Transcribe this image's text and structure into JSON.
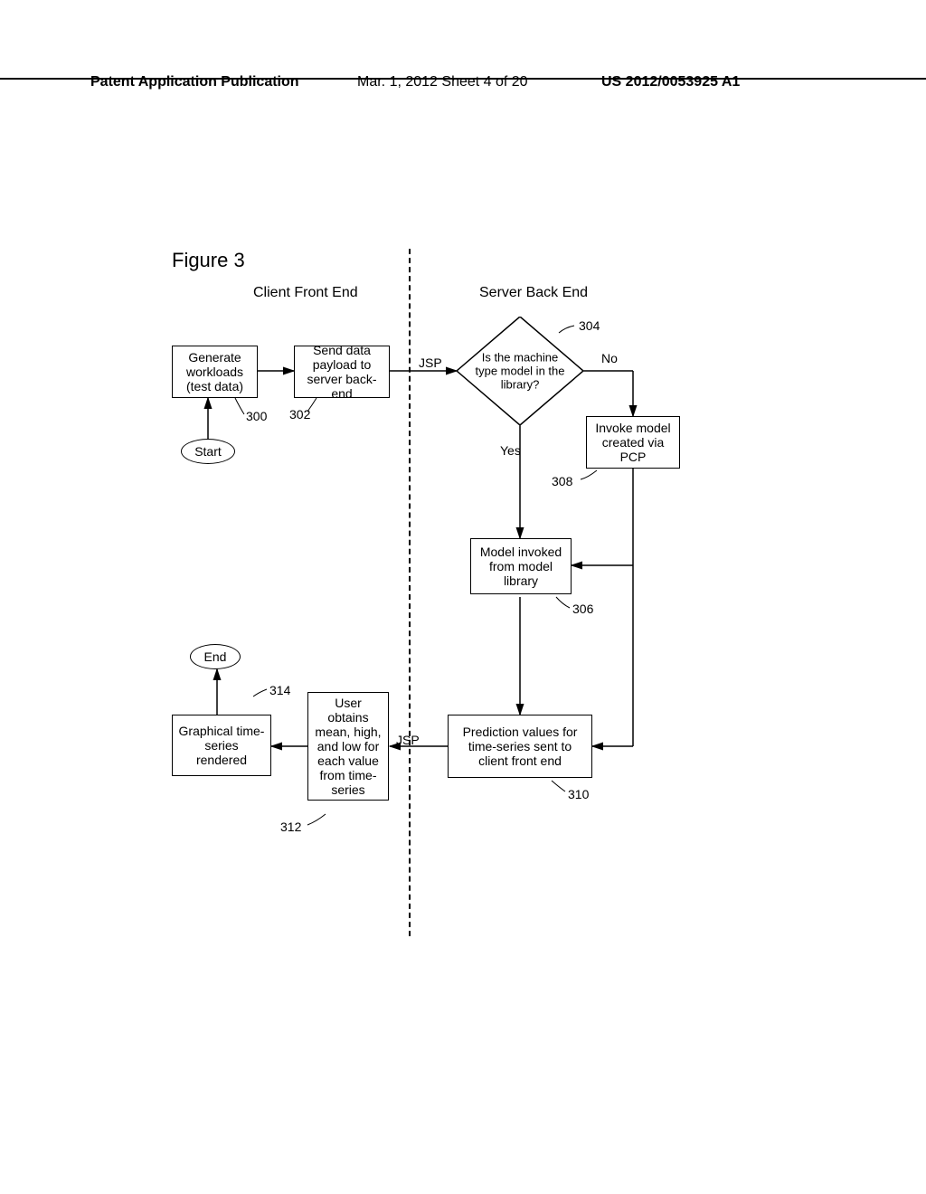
{
  "header": {
    "left": "Patent Application Publication",
    "center": "Mar. 1, 2012  Sheet 4 of 20",
    "right": "US 2012/0053925 A1"
  },
  "figure_label": "Figure 3",
  "sections": {
    "client": "Client Front End",
    "server": "Server Back End"
  },
  "nodes": {
    "start": "Start",
    "end": "End",
    "n300": "Generate workloads (test data)",
    "n302": "Send data payload to server back-end",
    "n304": "Is the machine type model in the library?",
    "n306": "Model invoked from model library",
    "n308": "Invoke model created via PCP",
    "n310": "Prediction values for time-series sent to client front end",
    "n312": "User obtains mean, high, and low for each value from time-series",
    "n314": "Graphical time-series rendered"
  },
  "refs": {
    "r300": "300",
    "r302": "302",
    "r304": "304",
    "r306": "306",
    "r308": "308",
    "r310": "310",
    "r312": "312",
    "r314": "314"
  },
  "labels": {
    "jsp": "JSP",
    "yes": "Yes",
    "no": "No"
  },
  "chart_data": {
    "type": "flowchart",
    "title": "Figure 3",
    "swimlanes": [
      "Client Front End",
      "Server Back End"
    ],
    "nodes": [
      {
        "id": "start",
        "type": "terminator",
        "label": "Start",
        "lane": "Client Front End"
      },
      {
        "id": "300",
        "type": "process",
        "label": "Generate workloads (test data)",
        "lane": "Client Front End"
      },
      {
        "id": "302",
        "type": "process",
        "label": "Send data payload to server back-end",
        "lane": "Client Front End"
      },
      {
        "id": "304",
        "type": "decision",
        "label": "Is the machine type model in the library?",
        "lane": "Server Back End"
      },
      {
        "id": "308",
        "type": "process",
        "label": "Invoke model created via PCP",
        "lane": "Server Back End"
      },
      {
        "id": "306",
        "type": "process",
        "label": "Model invoked from model library",
        "lane": "Server Back End"
      },
      {
        "id": "310",
        "type": "process",
        "label": "Prediction values for time-series sent to client front end",
        "lane": "Server Back End"
      },
      {
        "id": "312",
        "type": "process",
        "label": "User obtains mean, high, and low for each value from time-series",
        "lane": "Client Front End"
      },
      {
        "id": "314",
        "type": "process",
        "label": "Graphical time-series rendered",
        "lane": "Client Front End"
      },
      {
        "id": "end",
        "type": "terminator",
        "label": "End",
        "lane": "Client Front End"
      }
    ],
    "edges": [
      {
        "from": "start",
        "to": "300"
      },
      {
        "from": "300",
        "to": "302"
      },
      {
        "from": "302",
        "to": "304",
        "label": "JSP"
      },
      {
        "from": "304",
        "to": "308",
        "label": "No"
      },
      {
        "from": "304",
        "to": "306",
        "label": "Yes"
      },
      {
        "from": "308",
        "to": "306"
      },
      {
        "from": "306",
        "to": "310"
      },
      {
        "from": "310",
        "to": "312",
        "label": "JSP"
      },
      {
        "from": "312",
        "to": "314"
      },
      {
        "from": "314",
        "to": "end"
      }
    ]
  }
}
